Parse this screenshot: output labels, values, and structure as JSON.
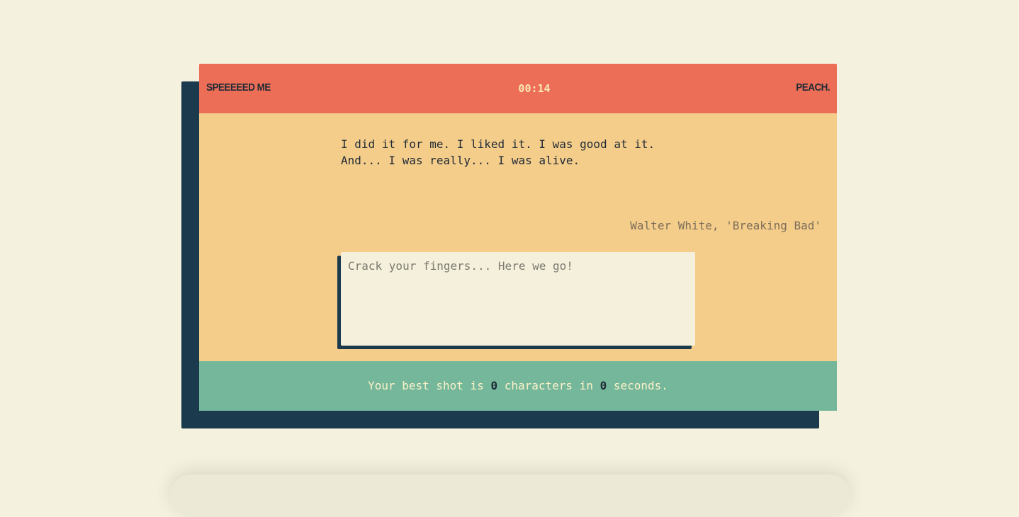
{
  "header": {
    "brand": "SPEEEEED ME",
    "timer": "00:14",
    "signature": "PEACH."
  },
  "quote": {
    "lines": [
      "I did it for me. I liked it. I was good at it.",
      "And... I was really... I was alive."
    ],
    "attribution": "Walter White, 'Breaking Bad'"
  },
  "input": {
    "placeholder": "Crack your fingers... Here we go!",
    "value": ""
  },
  "footer": {
    "prefix": "Your best shot is ",
    "characters": "0",
    "middle": " characters in ",
    "seconds": "0",
    "suffix": " seconds."
  },
  "colors": {
    "background": "#f4f2de",
    "header": "#ec6e57",
    "card": "#f5cd8b",
    "footer": "#75b79b",
    "shadow": "#1c3a4d"
  }
}
